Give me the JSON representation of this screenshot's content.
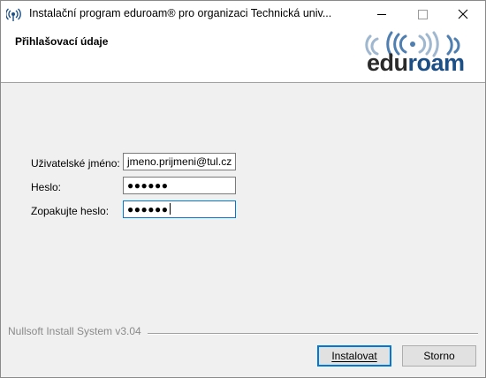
{
  "window": {
    "title": "Instalační program eduroam® pro organizaci Technická univ...",
    "icon": "eduroam-wifi-icon",
    "controls": {
      "minimize": "minimize-icon",
      "maximize": "maximize-icon",
      "close": "close-icon"
    }
  },
  "header": {
    "title": "Přihlašovací údaje",
    "logo": {
      "part1": "edu",
      "part2": "roam",
      "icon": "eduroam-logo"
    }
  },
  "form": {
    "username": {
      "label": "Uživatelské jméno:",
      "value": "jmeno.prijmeni@tul.cz"
    },
    "password": {
      "label": "Heslo:",
      "value": "●●●●●●"
    },
    "confirm": {
      "label": "Zopakujte heslo:",
      "value": "●●●●●●"
    }
  },
  "footer": {
    "branding": "Nullsoft Install System v3.04",
    "install_label": "Instalovat",
    "cancel_label": "Storno"
  },
  "colors": {
    "accent": "#0078d7",
    "logo_dark": "#2a2a2a",
    "logo_blue": "#1b4f86",
    "dialog_bg": "#f0f0f0"
  }
}
